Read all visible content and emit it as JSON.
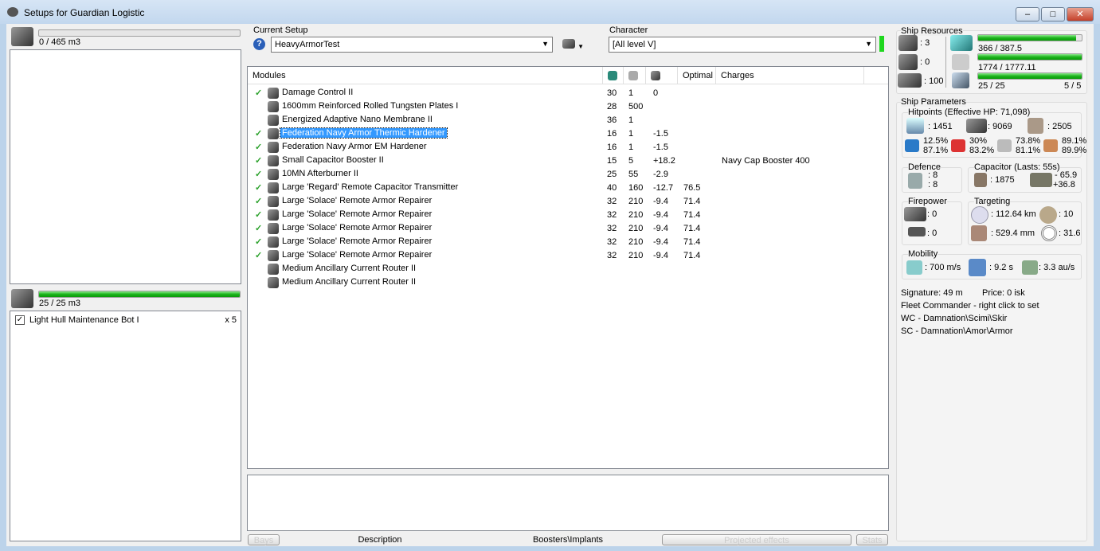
{
  "window": {
    "title": "Setups for Guardian Logistic",
    "minimize": "–",
    "maximize": "□",
    "close": "✕"
  },
  "cargo": {
    "label": "0 / 465 m3",
    "fill": 0
  },
  "drones": {
    "label": "25 / 25 m3",
    "fill": 1,
    "items": [
      {
        "name": "Light Hull Maintenance Bot I",
        "qty": "x 5",
        "checked": true
      }
    ]
  },
  "setup": {
    "label": "Current Setup",
    "value": "HeavyArmorTest",
    "help": "?"
  },
  "character": {
    "label": "Character",
    "value": "[All level V]"
  },
  "modules": {
    "headers": {
      "name": "Modules",
      "optimal": "Optimal",
      "charges": "Charges"
    },
    "rows": [
      {
        "active": true,
        "name": "Damage Control II",
        "cpu": "30",
        "pg": "1",
        "cap": "0",
        "optimal": "",
        "charges": ""
      },
      {
        "active": false,
        "name": "1600mm Reinforced Rolled Tungsten Plates I",
        "cpu": "28",
        "pg": "500",
        "cap": "",
        "optimal": "",
        "charges": ""
      },
      {
        "active": false,
        "name": "Energized Adaptive Nano Membrane II",
        "cpu": "36",
        "pg": "1",
        "cap": "",
        "optimal": "",
        "charges": ""
      },
      {
        "active": true,
        "name": "Federation Navy Armor Thermic Hardener",
        "cpu": "16",
        "pg": "1",
        "cap": "-1.5",
        "optimal": "",
        "charges": "",
        "selected": true
      },
      {
        "active": true,
        "name": "Federation Navy Armor EM Hardener",
        "cpu": "16",
        "pg": "1",
        "cap": "-1.5",
        "optimal": "",
        "charges": ""
      },
      {
        "active": true,
        "name": "Small Capacitor Booster II",
        "cpu": "15",
        "pg": "5",
        "cap": "+18.2",
        "optimal": "",
        "charges": "Navy Cap Booster 400"
      },
      {
        "active": true,
        "name": "10MN Afterburner II",
        "cpu": "25",
        "pg": "55",
        "cap": "-2.9",
        "optimal": "",
        "charges": ""
      },
      {
        "active": true,
        "name": "Large 'Regard' Remote Capacitor Transmitter",
        "cpu": "40",
        "pg": "160",
        "cap": "-12.7",
        "optimal": "76.5",
        "charges": ""
      },
      {
        "active": true,
        "name": "Large 'Solace' Remote Armor Repairer",
        "cpu": "32",
        "pg": "210",
        "cap": "-9.4",
        "optimal": "71.4",
        "charges": ""
      },
      {
        "active": true,
        "name": "Large 'Solace' Remote Armor Repairer",
        "cpu": "32",
        "pg": "210",
        "cap": "-9.4",
        "optimal": "71.4",
        "charges": ""
      },
      {
        "active": true,
        "name": "Large 'Solace' Remote Armor Repairer",
        "cpu": "32",
        "pg": "210",
        "cap": "-9.4",
        "optimal": "71.4",
        "charges": ""
      },
      {
        "active": true,
        "name": "Large 'Solace' Remote Armor Repairer",
        "cpu": "32",
        "pg": "210",
        "cap": "-9.4",
        "optimal": "71.4",
        "charges": ""
      },
      {
        "active": true,
        "name": "Large 'Solace' Remote Armor Repairer",
        "cpu": "32",
        "pg": "210",
        "cap": "-9.4",
        "optimal": "71.4",
        "charges": ""
      },
      {
        "active": false,
        "name": "Medium Ancillary Current Router II",
        "cpu": "",
        "pg": "",
        "cap": "",
        "optimal": "",
        "charges": ""
      },
      {
        "active": false,
        "name": "Medium Ancillary Current Router II",
        "cpu": "",
        "pg": "",
        "cap": "",
        "optimal": "",
        "charges": ""
      }
    ]
  },
  "tabs": {
    "bays": "Bays",
    "description": "Description",
    "boosters": "Boosters\\Implants",
    "projected": "Projected effects",
    "stats": "Stats"
  },
  "resources": {
    "title": "Ship Resources",
    "turrets": ": 3",
    "launchers": ": 0",
    "calibration": ": 100",
    "cpu": "366 / 387.5",
    "cpu_fill": 0.945,
    "pg": "1774 / 1777.11",
    "pg_fill": 0.998,
    "drone_bw": "25 / 25",
    "drone_bw_fill": 1,
    "drones_active": "5 / 5"
  },
  "params": {
    "title": "Ship Parameters",
    "hp_title": "Hitpoints (Effective HP: 71,098)",
    "shield": ": 1451",
    "armor": ": 9069",
    "structure": ": 2505",
    "resists": [
      [
        "12.5%",
        "87.1%"
      ],
      [
        "30%",
        "83.2%"
      ],
      [
        "73.8%",
        "81.1%"
      ],
      [
        "89.1%",
        "89.9%"
      ]
    ],
    "defence_title": "Defence",
    "def1": ": 8",
    "def2": ": 8",
    "cap_title": "Capacitor (Lasts: 55s)",
    "cap_amount": ": 1875",
    "cap_delta1": "- 65.9",
    "cap_delta2": "+36.8",
    "fire_title": "Firepower",
    "fire1": ": 0",
    "fire2": ": 0",
    "target_title": "Targeting",
    "range": ": 112.64 km",
    "targets": ": 10",
    "scanres": ": 529.4 mm",
    "sensor": ": 31.6",
    "mob_title": "Mobility",
    "speed": ": 700 m/s",
    "align": ": 9.2 s",
    "warp": ": 3.3 au/s",
    "signature": "Signature: 49 m",
    "price": "Price: 0 isk",
    "fleet": "Fleet Commander - right click to set",
    "wc": "WC - Damnation\\Scimi\\Skir",
    "sc": "SC - Damnation\\Amor\\Armor"
  }
}
